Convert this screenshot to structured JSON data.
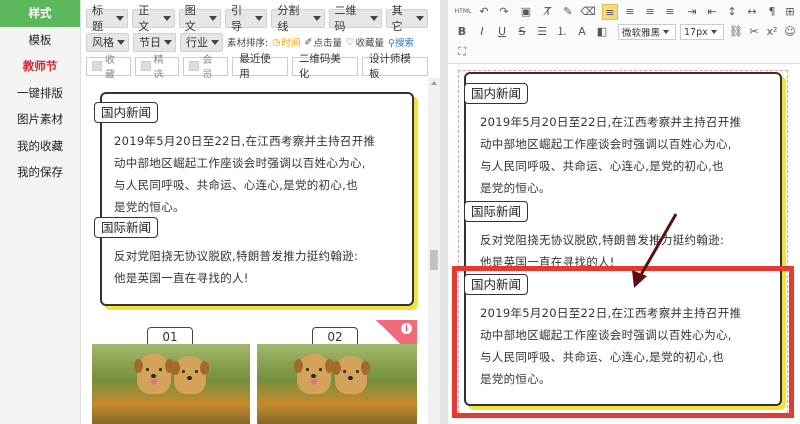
{
  "sidebar": {
    "items": [
      {
        "label": "样式",
        "state": "active"
      },
      {
        "label": "模板",
        "state": "normal"
      },
      {
        "label": "教师节",
        "state": "highlight"
      },
      {
        "label": "一键排版",
        "state": "normal"
      },
      {
        "label": "图片素材",
        "state": "normal"
      },
      {
        "label": "我的收藏",
        "state": "normal"
      },
      {
        "label": "我的保存",
        "state": "normal"
      }
    ]
  },
  "filters": {
    "row1": [
      "标题",
      "正文",
      "图文",
      "引导",
      "分割线",
      "二维码",
      "其它"
    ],
    "row2": [
      "风格",
      "节日",
      "行业"
    ],
    "sort_label": "素材排序:",
    "sort_options": [
      {
        "label": "时间",
        "icon": "clock-icon"
      },
      {
        "label": "点击量",
        "icon": "pointer-icon"
      },
      {
        "label": "收藏量",
        "icon": "heart-icon"
      }
    ],
    "search_label": "搜索",
    "checkboxes": [
      "收藏",
      "精选",
      "会员"
    ],
    "buttons": [
      "最近使用",
      "二维码美化",
      "设计师模板"
    ]
  },
  "templates": {
    "card1": {
      "domestic_title": "国内新闻",
      "domestic_lines": [
        "2019年5月20日至22日,在江西考察并主持召开推",
        "动中部地区崛起工作座谈会时强调以百姓心为心,",
        "与人民同呼吸、共命运、心连心,是党的初心,也",
        "是党的恒心。"
      ],
      "intl_title": "国际新闻",
      "intl_lines": [
        "反对党阻挠无协议脱欧,特朗普发推力挺约翰逊:",
        "他是英国一直在寻找的人!"
      ]
    },
    "image_tags": [
      "01",
      "02"
    ],
    "ribbon_icon": "info-icon"
  },
  "editor": {
    "toolbar": {
      "font_family": "微软雅黑",
      "font_size": "17px",
      "html_label": "HTML",
      "icons": [
        "html-icon",
        "undo-icon",
        "redo-icon",
        "image-icon",
        "clear-format-icon",
        "format-painter-icon",
        "erase-icon",
        "align-left-icon",
        "align-center-icon",
        "align-right-icon",
        "align-justify-icon",
        "indent-icon",
        "outdent-icon",
        "line-height-icon",
        "letter-spacing-icon",
        "paragraph-icon",
        "table-icon",
        "bold-icon",
        "italic-icon",
        "underline-icon",
        "strikethrough-icon",
        "list-icon",
        "ordered-list-icon",
        "font-color-icon",
        "background-color-icon",
        "link-icon",
        "unlink-icon",
        "superscript-icon",
        "emoji-icon",
        "fullscreen-icon"
      ]
    },
    "block1": {
      "domestic_title": "国内新闻",
      "domestic_lines": [
        "2019年5月20日至22日,在江西考察并主持召开推",
        "动中部地区崛起工作座谈会时强调以百姓心为心,",
        "与人民同呼吸、共命运、心连心,是党的初心,也",
        "是党的恒心。"
      ],
      "intl_title": "国际新闻",
      "intl_lines": [
        "反对党阻挠无协议脱欧,特朗普发推力挺约翰逊:",
        "他是英国一直在寻找的人!"
      ]
    },
    "block2": {
      "domestic_title": "国内新闻",
      "domestic_lines": [
        "2019年5月20日至22日,在江西考察并主持召开推",
        "动中部地区崛起工作座谈会时强调以百姓心为心,",
        "与人民同呼吸、共命运、心连心,是党的初心,也",
        "是党的恒心。"
      ]
    }
  },
  "colors": {
    "accent_green": "#5cb85c",
    "highlight_red": "#e53935",
    "card_shadow_yellow": "#f3e23a"
  }
}
